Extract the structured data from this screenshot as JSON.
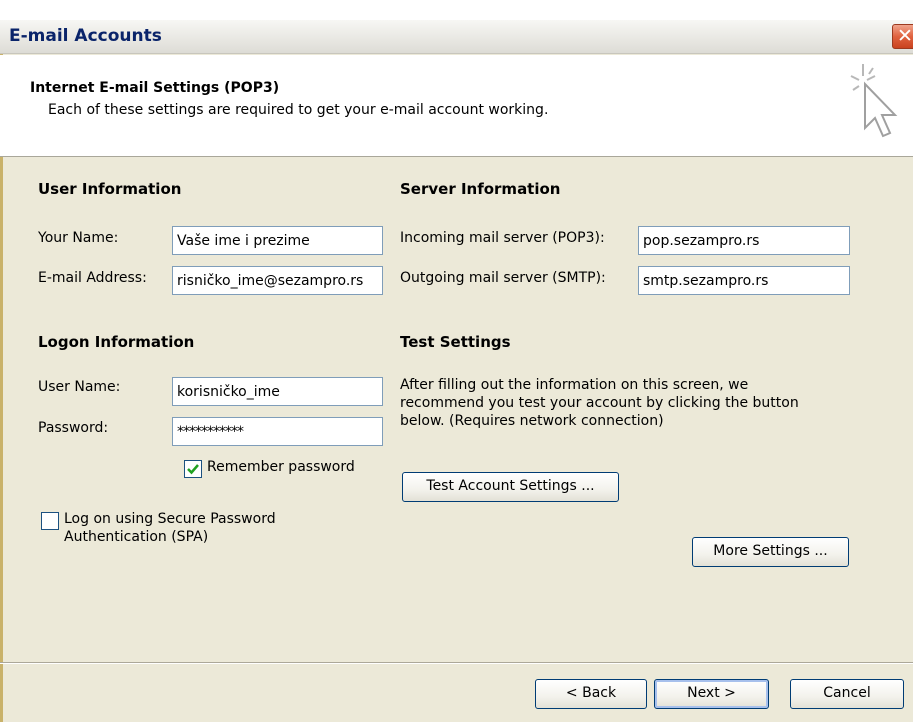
{
  "window": {
    "title": "E-mail Accounts"
  },
  "header": {
    "title": "Internet E-mail Settings (POP3)",
    "subtitle": "Each of these settings are required to get your e-mail account working.",
    "icon": "cursor-sparkle-icon"
  },
  "user_info": {
    "title": "User Information",
    "name_label": "Your Name:",
    "name_value": "Vaše ime i prezime",
    "email_label": "E-mail Address:",
    "email_value": "risničko_ime@sezampro.rs"
  },
  "server_info": {
    "title": "Server Information",
    "incoming_label": "Incoming mail server (POP3):",
    "incoming_value": "pop.sezampro.rs",
    "outgoing_label": "Outgoing mail server (SMTP):",
    "outgoing_value": "smtp.sezampro.rs"
  },
  "logon_info": {
    "title": "Logon Information",
    "username_label": "User Name:",
    "username_value": "korisničko_ime",
    "password_label": "Password:",
    "password_value": "***********",
    "remember_label": "Remember password",
    "remember_checked": true,
    "spa_label": "Log on using Secure Password Authentication (SPA)",
    "spa_label_line1": "Log on using Secure Password",
    "spa_label_line2": "Authentication (SPA)",
    "spa_checked": false
  },
  "test_settings": {
    "title": "Test Settings",
    "description": "After filling out the information on this screen, we recommend you test your account by clicking the button below. (Requires network connection)",
    "test_button": "Test Account Settings ...",
    "more_button": "More Settings ..."
  },
  "footer": {
    "back_button": "< Back",
    "next_button": "Next >",
    "cancel_button": "Cancel"
  },
  "colors": {
    "dialog_bg": "#ece9d8",
    "title_text": "#0a246a",
    "close_button": "#e0623f",
    "input_border": "#7f9db9",
    "check_mark": "#21a121"
  }
}
